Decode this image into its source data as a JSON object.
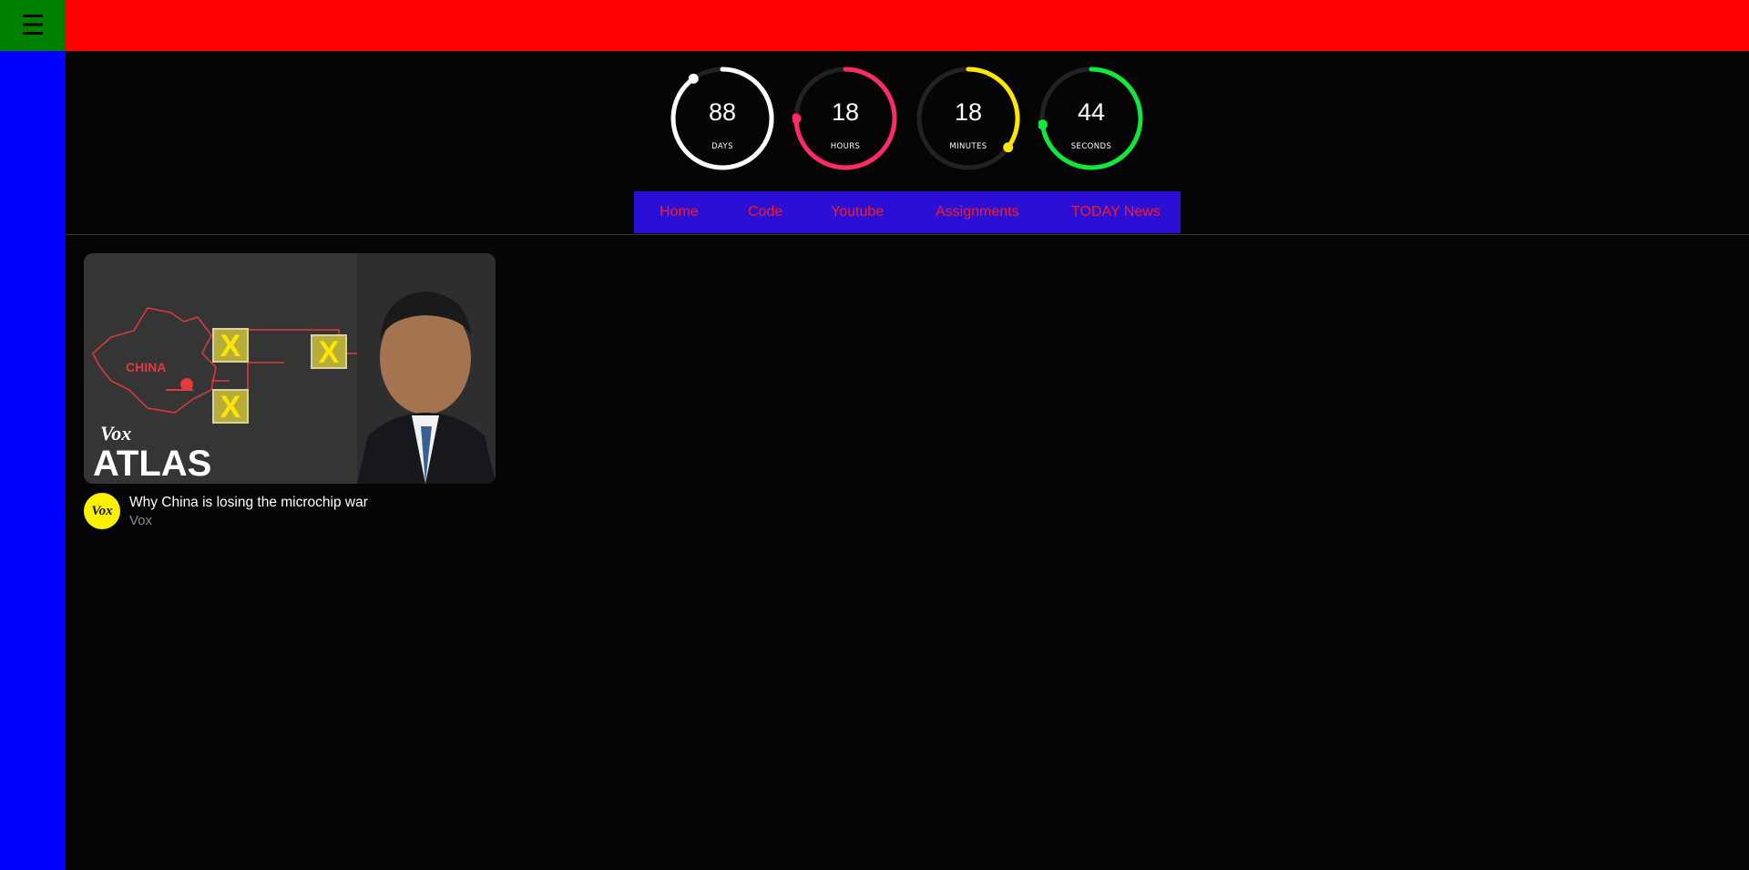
{
  "header": {
    "menu_icon": "hamburger-icon",
    "menu_glyph": "☰",
    "bar_color": "#ff0000",
    "menu_color": "#008000"
  },
  "sidebar": {
    "color": "#0000ff"
  },
  "countdown": [
    {
      "value": "88",
      "unit": "DAYS",
      "color": "#ffffff",
      "fraction": 0.9
    },
    {
      "value": "18",
      "unit": "HOURS",
      "color": "#ff2a68",
      "fraction": 0.75
    },
    {
      "value": "18",
      "unit": "MINUTES",
      "color": "#ffe600",
      "fraction": 0.35
    },
    {
      "value": "44",
      "unit": "SECONDS",
      "color": "#10e83a",
      "fraction": 0.73
    }
  ],
  "nav": {
    "items": [
      {
        "label": "Home"
      },
      {
        "label": "Code"
      },
      {
        "label": "Youtube"
      },
      {
        "label": "Assignments"
      },
      {
        "label": "TODAY News"
      }
    ],
    "background": "#2a0fd4",
    "text_color": "#ff1a1a"
  },
  "videos": [
    {
      "title": "Why China is losing the microchip war",
      "channel": "Vox",
      "avatar_text": "Vox",
      "thumbnail": {
        "brand": "Vox",
        "series": "ATLAS",
        "map_label": "CHINA",
        "marker": "X"
      }
    }
  ]
}
